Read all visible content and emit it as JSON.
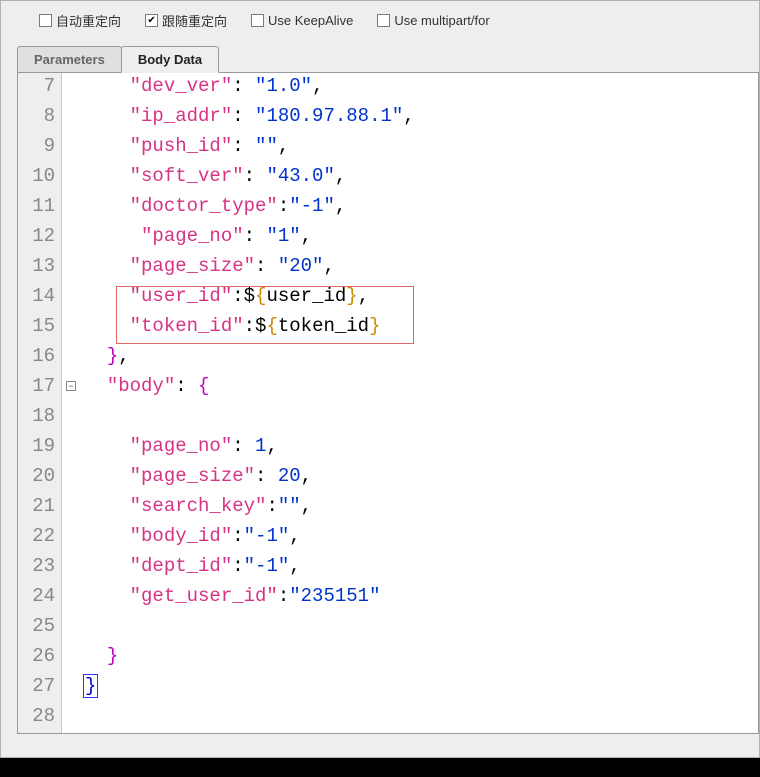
{
  "options": {
    "auto_redirect": {
      "label": "自动重定向",
      "checked": false
    },
    "follow_redirect": {
      "label": "跟随重定向",
      "checked": true
    },
    "keepalive": {
      "label": "Use KeepAlive",
      "checked": false
    },
    "multipart": {
      "label": "Use multipart/for",
      "checked": false
    }
  },
  "tabs": {
    "parameters": "Parameters",
    "body_data": "Body Data"
  },
  "code_lines": [
    {
      "ln": 7,
      "indent": "    ",
      "key": "dev_ver",
      "sep": ": ",
      "val": "\"1.0\"",
      "tail": ",",
      "valtype": "s"
    },
    {
      "ln": 8,
      "indent": "    ",
      "key": "ip_addr",
      "sep": ": ",
      "val": "\"180.97.88.1\"",
      "tail": ",",
      "valtype": "s"
    },
    {
      "ln": 9,
      "indent": "    ",
      "key": "push_id",
      "sep": ": ",
      "val": "\"\"",
      "tail": ",",
      "valtype": "s"
    },
    {
      "ln": 10,
      "indent": "    ",
      "key": "soft_ver",
      "sep": ": ",
      "val": "\"43.0\"",
      "tail": ",",
      "valtype": "s"
    },
    {
      "ln": 11,
      "indent": "    ",
      "key": "doctor_type",
      "sep": ":",
      "val": "\"-1\"",
      "tail": ",",
      "valtype": "s"
    },
    {
      "ln": 12,
      "indent": "     ",
      "key": "page_no",
      "sep": ": ",
      "val": "\"1\"",
      "tail": ",",
      "valtype": "s"
    },
    {
      "ln": 13,
      "indent": "    ",
      "key": "page_size",
      "sep": ": ",
      "val": "\"20\"",
      "tail": ",",
      "valtype": "s"
    },
    {
      "ln": 14,
      "indent": "    ",
      "key": "user_id",
      "sep": ":",
      "val": "${user_id}",
      "tail": ",",
      "valtype": "var"
    },
    {
      "ln": 15,
      "indent": "    ",
      "key": "token_id",
      "sep": ":",
      "val": "${token_id}",
      "tail": "",
      "valtype": "var"
    },
    {
      "ln": 16,
      "raw_close": "  }",
      "tail": ",",
      "brace": "br-m"
    },
    {
      "ln": 17,
      "indent": "  ",
      "key": "body",
      "sep": ": ",
      "open_brace": "{",
      "brace": "br-m",
      "fold": true
    },
    {
      "ln": 18,
      "blank": true
    },
    {
      "ln": 19,
      "indent": "    ",
      "key": "page_no",
      "sep": ": ",
      "val": "1",
      "tail": ",",
      "valtype": "n"
    },
    {
      "ln": 20,
      "indent": "    ",
      "key": "page_size",
      "sep": ": ",
      "val": "20",
      "tail": ",",
      "valtype": "n"
    },
    {
      "ln": 21,
      "indent": "    ",
      "key": "search_key",
      "sep": ":",
      "val": "\"\"",
      "tail": ",",
      "valtype": "s"
    },
    {
      "ln": 22,
      "indent": "    ",
      "key": "body_id",
      "sep": ":",
      "val": "\"-1\"",
      "tail": ",",
      "valtype": "s"
    },
    {
      "ln": 23,
      "indent": "    ",
      "key": "dept_id",
      "sep": ":",
      "val": "\"-1\"",
      "tail": ",",
      "valtype": "s"
    },
    {
      "ln": 24,
      "indent": "    ",
      "key": "get_user_id",
      "sep": ":",
      "val": "\"235151\"",
      "tail": "",
      "valtype": "s"
    },
    {
      "ln": 25,
      "blank": true
    },
    {
      "ln": 26,
      "raw_close": "  }",
      "brace": "br-m"
    },
    {
      "ln": 27,
      "raw_close": "}",
      "brace": "br-b",
      "caret": true
    },
    {
      "ln": 28,
      "blank": true
    }
  ]
}
